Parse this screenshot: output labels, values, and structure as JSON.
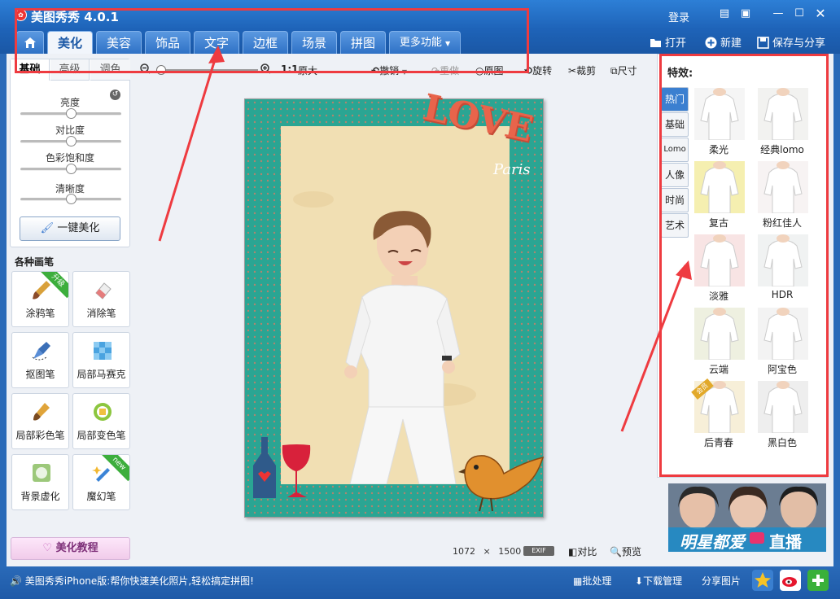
{
  "app": {
    "title": "美图秀秀 4.0.1",
    "login": "登录"
  },
  "nav": {
    "tabs": [
      "美化",
      "美容",
      "饰品",
      "文字",
      "边框",
      "场景",
      "拼图",
      "更多功能"
    ],
    "actions": {
      "open": "打开",
      "new": "新建",
      "save_share": "保存与分享"
    }
  },
  "left": {
    "subtabs": [
      "基础",
      "高级",
      "调色"
    ],
    "sliders": [
      {
        "label": "亮度",
        "level": 0.5
      },
      {
        "label": "对比度",
        "level": 0.5
      },
      {
        "label": "色彩饱和度",
        "level": 0.5
      },
      {
        "label": "清晰度",
        "level": 0.5
      }
    ],
    "one_click": "一键美化",
    "brush_section": "各种画笔",
    "brushes": [
      {
        "label": "涂鸦笔",
        "badge": "升级"
      },
      {
        "label": "消除笔",
        "badge": ""
      },
      {
        "label": "抠图笔",
        "badge": ""
      },
      {
        "label": "局部马赛克",
        "badge": ""
      },
      {
        "label": "局部彩色笔",
        "badge": ""
      },
      {
        "label": "局部变色笔",
        "badge": ""
      },
      {
        "label": "背景虚化",
        "badge": ""
      },
      {
        "label": "魔幻笔",
        "badge": "new"
      }
    ],
    "tutorial": "美化教程"
  },
  "toolbar": {
    "zoom_ratio": "1:1",
    "original_size": "原大",
    "undo": "撤销",
    "redo": "重做",
    "original": "原图",
    "rotate": "旋转",
    "crop": "裁剪",
    "size": "尺寸"
  },
  "canvas": {
    "width_px": "1072",
    "times": "×",
    "height_px": "1500",
    "exif": "EXIF",
    "love": "LOVE",
    "paris": "Paris"
  },
  "bottom_actions": {
    "compare": "对比",
    "preview": "预览"
  },
  "effects": {
    "title": "特效:",
    "categories": [
      "热门",
      "基础",
      "Lomo",
      "人像",
      "时尚",
      "艺术"
    ],
    "items": [
      {
        "label": "柔光",
        "tint": "#f5f5f5"
      },
      {
        "label": "经典lomo",
        "tint": "#f2f2f0"
      },
      {
        "label": "复古",
        "tint": "#f5efb0"
      },
      {
        "label": "粉红佳人",
        "tint": "#f7f3f3"
      },
      {
        "label": "淡雅",
        "tint": "#f8e4e4"
      },
      {
        "label": "HDR",
        "tint": "#f0f2f2"
      },
      {
        "label": "云端",
        "tint": "#eef0e0"
      },
      {
        "label": "阿宝色",
        "tint": "#f3f3f3"
      },
      {
        "label": "后青春",
        "tint": "#f7efd8",
        "badge": "会员"
      },
      {
        "label": "黑白色",
        "tint": "#eeeeee"
      }
    ]
  },
  "ad": {
    "text": "明星都爱",
    "live": "直播"
  },
  "status": {
    "message": "美图秀秀iPhone版:帮你快速美化照片,轻松搞定拼图!",
    "batch": "批处理",
    "download": "下载管理",
    "share": "分享图片"
  },
  "colors": {
    "accent": "#2f72c6",
    "annotation": "#ee3b40",
    "frame": "#2aa593"
  }
}
